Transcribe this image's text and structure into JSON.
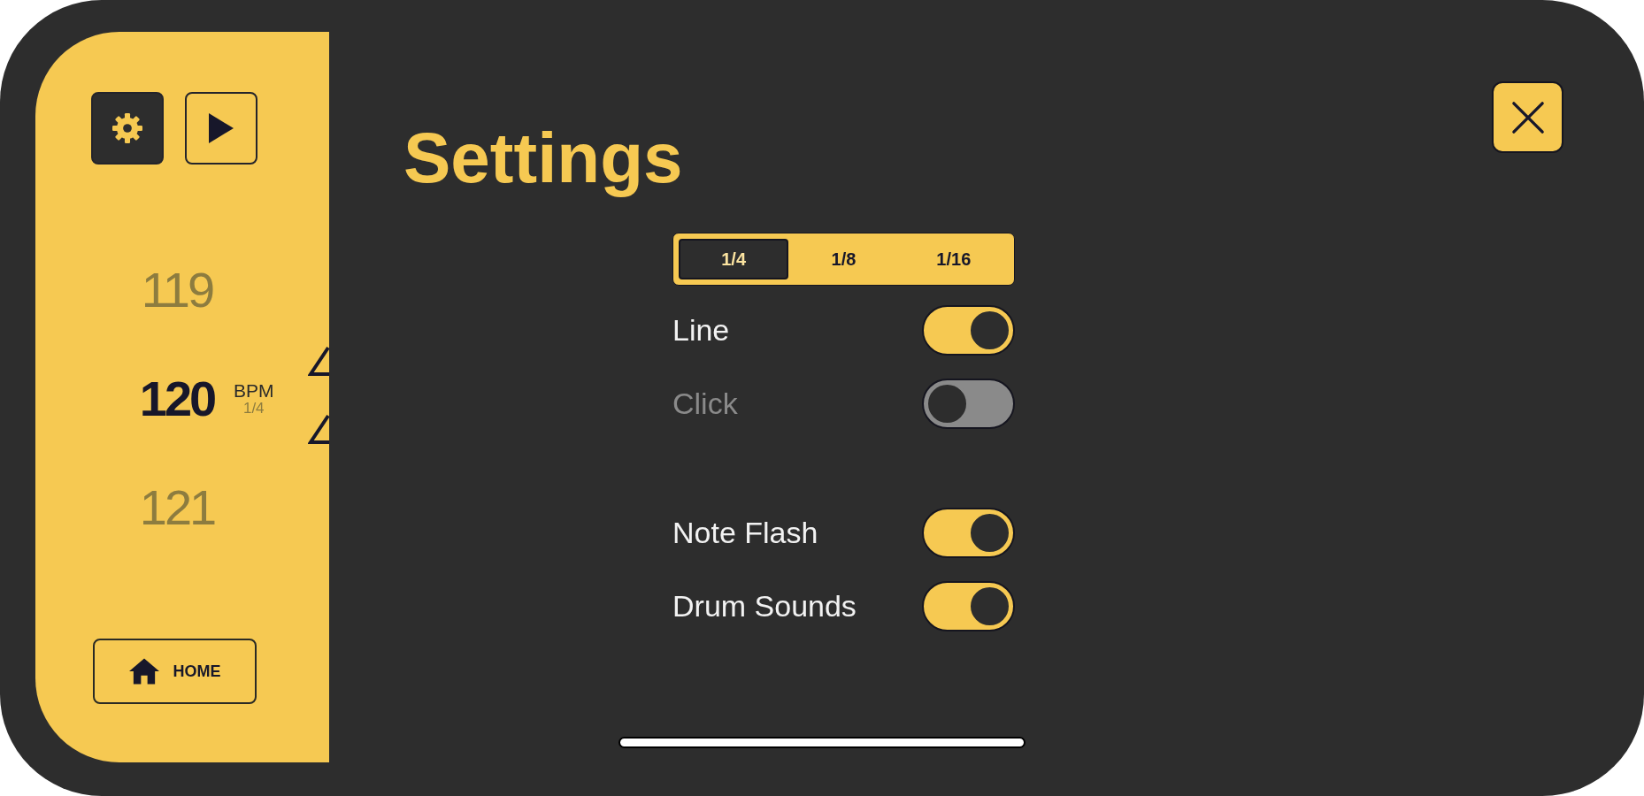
{
  "sidebar": {
    "buttons": [
      {
        "kind": "gear",
        "selected": true
      },
      {
        "kind": "play",
        "selected": false
      }
    ],
    "tempo_list": [
      {
        "value": "119",
        "selected": false
      },
      {
        "value": "120",
        "selected": true,
        "unit": "BPM",
        "note": "1/4"
      },
      {
        "value": "121",
        "selected": false
      }
    ],
    "home_button": {
      "label": "HOME"
    }
  },
  "settings": {
    "title": "Settings",
    "note_values": [
      {
        "label": "1/4",
        "selected": true
      },
      {
        "label": "1/8",
        "selected": false
      },
      {
        "label": "1/16",
        "selected": false
      }
    ],
    "toggle_groups": [
      {
        "rows": [
          {
            "label": "Line",
            "on": true,
            "disabled": false
          },
          {
            "label": "Click",
            "on": false,
            "disabled": true
          }
        ]
      },
      {
        "rows": [
          {
            "label": "Note Flash",
            "on": true,
            "disabled": false
          },
          {
            "label": "Drum Sounds",
            "on": true,
            "disabled": false
          }
        ]
      }
    ]
  }
}
